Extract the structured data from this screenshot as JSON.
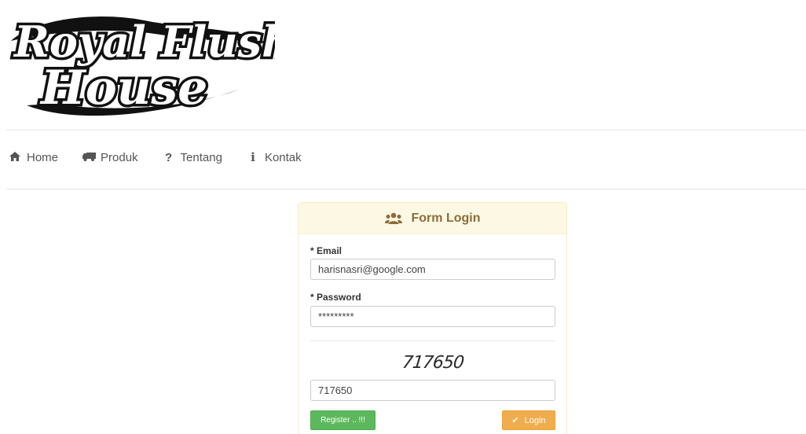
{
  "logo": {
    "line1": "Royal Flush",
    "line2": "House"
  },
  "nav": {
    "items": [
      {
        "label": "Home",
        "icon": "home-icon"
      },
      {
        "label": "Produk",
        "icon": "truck-icon"
      },
      {
        "label": "Tentang",
        "icon": "question-icon"
      },
      {
        "label": "Kontak",
        "icon": "info-icon"
      }
    ]
  },
  "form": {
    "title": "Form Login",
    "title_icon": "users-icon",
    "email_label": "* Email",
    "email_value": "harisnasri@google.com",
    "password_label": "* Password",
    "password_value": "*********",
    "captcha_text": "717650",
    "captcha_value": "717650",
    "register_label": "Register .. !!!",
    "login_label": "Login",
    "login_icon": "check-icon"
  },
  "colors": {
    "panel_heading_bg": "#fcf8e3",
    "panel_heading_text": "#8a6d3b",
    "register_bg": "#5cb85c",
    "login_bg": "#f0ad4e"
  }
}
